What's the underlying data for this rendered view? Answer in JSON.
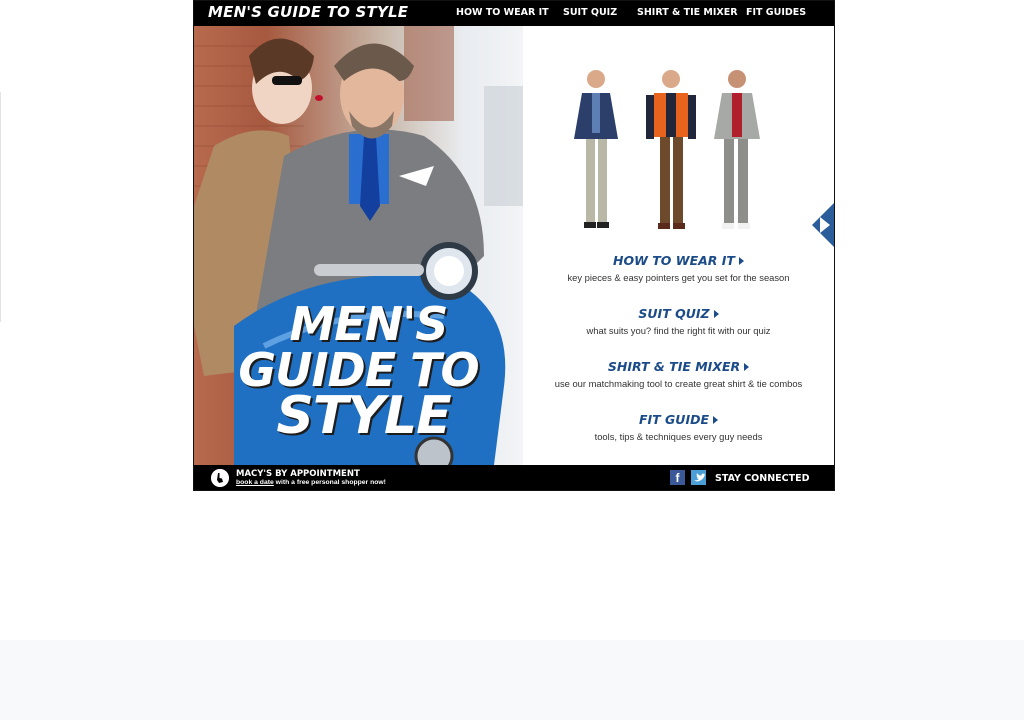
{
  "header": {
    "brand": "MEN'S GUIDE TO STYLE",
    "nav": [
      "HOW TO WEAR IT",
      "SUIT QUIZ",
      "SHIRT & TIE MIXER",
      "FIT GUIDES"
    ]
  },
  "hero": {
    "title_lines": [
      "MEN'S",
      "GUIDE TO",
      "STYLE"
    ]
  },
  "links": [
    {
      "title": "HOW TO WEAR IT",
      "subtitle": "key pieces & easy pointers get you set for the season"
    },
    {
      "title": "SUIT QUIZ",
      "subtitle": "what suits you? find the right fit with our quiz"
    },
    {
      "title": "SHIRT & TIE MIXER",
      "subtitle": "use our matchmaking tool to create great shirt & tie combos"
    },
    {
      "title": "FIT GUIDE",
      "subtitle": "tools, tips & techniques every guy needs"
    }
  ],
  "footer": {
    "appointment_title": "MACY'S BY APPOINTMENT",
    "appointment_link": "book a date",
    "appointment_text": " with a free personal shopper now!",
    "social_label": "STAY CONNECTED",
    "facebook_glyph": "f"
  },
  "icons": [
    "hand-pointer-icon",
    "facebook-icon",
    "twitter-icon",
    "next-arrow-icon",
    "triangle-right-icon"
  ],
  "colors": {
    "bar_background": "#000000",
    "link_blue": "#1b4b88",
    "facebook": "#3b5998",
    "twitter": "#4b9fd6",
    "scooter_blue": "#1f6fc2"
  }
}
